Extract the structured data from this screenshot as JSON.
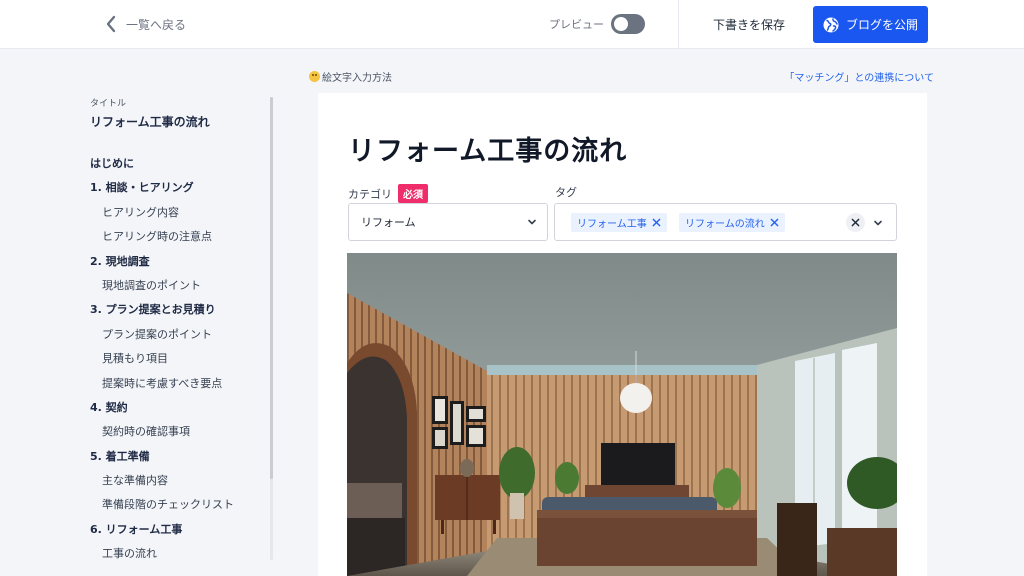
{
  "header": {
    "back_label": "一覧へ戻る",
    "preview_label": "プレビュー",
    "preview_enabled": false,
    "save_draft_label": "下書きを保存",
    "publish_label": "ブログを公開",
    "publish_color": "#1a56f0"
  },
  "toc": {
    "small_label": "タイトル",
    "title": "リフォーム工事の流れ",
    "items": [
      {
        "label": "はじめに",
        "level": 1
      },
      {
        "label": "1. 相談・ヒアリング",
        "level": 1
      },
      {
        "label": "ヒアリング内容",
        "level": 2
      },
      {
        "label": "ヒアリング時の注意点",
        "level": 2
      },
      {
        "label": "2. 現地調査",
        "level": 1
      },
      {
        "label": "現地調査のポイント",
        "level": 2
      },
      {
        "label": "3. プラン提案とお見積り",
        "level": 1
      },
      {
        "label": "プラン提案のポイント",
        "level": 2
      },
      {
        "label": "見積もり項目",
        "level": 2
      },
      {
        "label": "提案時に考慮すべき要点",
        "level": 2
      },
      {
        "label": "4. 契約",
        "level": 1
      },
      {
        "label": "契約時の確認事項",
        "level": 2
      },
      {
        "label": "5. 着工準備",
        "level": 1
      },
      {
        "label": "主な準備内容",
        "level": 2
      },
      {
        "label": "準備段階のチェックリスト",
        "level": 2
      },
      {
        "label": "6. リフォーム工事",
        "level": 1
      },
      {
        "label": "工事の流れ",
        "level": 2
      }
    ]
  },
  "editor": {
    "emoji_help": "絵文字入力方法",
    "matching_link": "「マッチング」との連携について",
    "title": "リフォーム工事の流れ",
    "category_label": "カテゴリ",
    "required_badge": "必須",
    "category_value": "リフォーム",
    "tag_label": "タグ",
    "tags": [
      "リフォーム工事",
      "リフォームの流れ"
    ],
    "accent_color": "#ef2d6b"
  }
}
